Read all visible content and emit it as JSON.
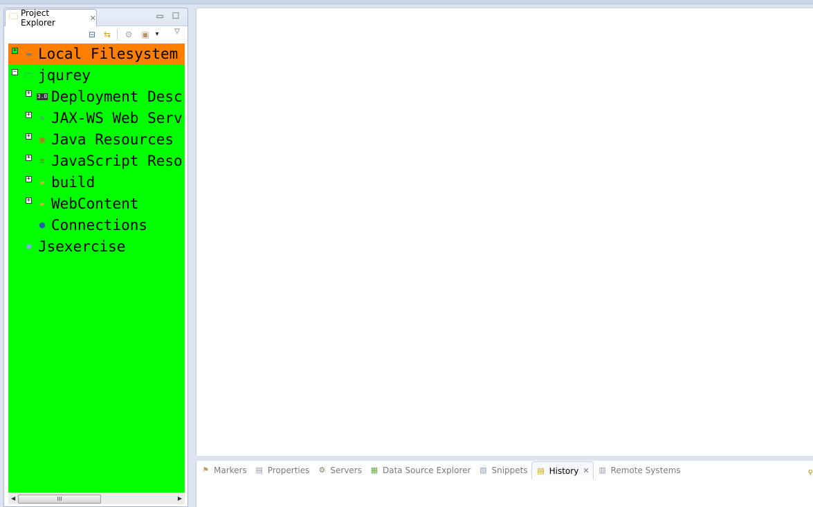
{
  "project_explorer": {
    "tab_label": "Project Explorer",
    "close_glyph": "✕",
    "minimize_glyph": "▭",
    "maximize_glyph": "☐",
    "toolbar": [
      {
        "name": "collapse-all-icon",
        "glyph": "⊟"
      },
      {
        "name": "link-with-editor-icon",
        "glyph": "⇆"
      },
      {
        "name": "filter-icon",
        "glyph": "⚙"
      },
      {
        "name": "package-icon",
        "glyph": "▣"
      },
      {
        "name": "dropdown-arrow-icon",
        "glyph": "▾"
      },
      {
        "name": "view-menu-icon",
        "glyph": "▽"
      }
    ],
    "tree": [
      {
        "label": "Local Filesystem",
        "icon": "drive-icon",
        "glyph": "▬",
        "level": 0,
        "expander": "+",
        "selected": true
      },
      {
        "label": "jqurey",
        "icon": "web-project-icon",
        "glyph": "🗁",
        "level": 0,
        "expander": "−",
        "selected": false
      },
      {
        "label": "Deployment Desc",
        "icon": "deployment-descriptor-icon",
        "glyph": "3.0",
        "level": 1,
        "expander": "+",
        "selected": false
      },
      {
        "label": "JAX-WS Web Serv",
        "icon": "web-services-icon",
        "glyph": "✎",
        "level": 1,
        "expander": "+",
        "selected": false
      },
      {
        "label": "Java Resources",
        "icon": "java-resources-icon",
        "glyph": "▦",
        "level": 1,
        "expander": "+",
        "selected": false
      },
      {
        "label": "JavaScript Reso",
        "icon": "javascript-resources-icon",
        "glyph": "≡",
        "level": 1,
        "expander": "+",
        "selected": false
      },
      {
        "label": "build",
        "icon": "folder-icon",
        "glyph": "▰",
        "level": 1,
        "expander": "+",
        "selected": false
      },
      {
        "label": "WebContent",
        "icon": "folder-icon",
        "glyph": "▰",
        "level": 1,
        "expander": "+",
        "selected": false
      },
      {
        "label": "Connections",
        "icon": "globe-icon",
        "glyph": "●",
        "level": 1,
        "expander": "",
        "selected": false
      },
      {
        "label": "Jsexercise",
        "icon": "closed-project-icon",
        "glyph": "■",
        "level": 0,
        "expander": "",
        "selected": false
      }
    ],
    "scrollbar": {
      "thumb_grip": "III",
      "left_arrow": "◀",
      "right_arrow": "▶"
    }
  },
  "bottom_panel": {
    "tabs": [
      {
        "label": "Markers",
        "icon": "markers-icon",
        "glyph": "⚑",
        "active": false
      },
      {
        "label": "Properties",
        "icon": "properties-icon",
        "glyph": "▤",
        "active": false
      },
      {
        "label": "Servers",
        "icon": "servers-icon",
        "glyph": "⚙",
        "active": false
      },
      {
        "label": "Data Source Explorer",
        "icon": "data-source-explorer-icon",
        "glyph": "▦",
        "active": false
      },
      {
        "label": "Snippets",
        "icon": "snippets-icon",
        "glyph": "▧",
        "active": false
      },
      {
        "label": "History",
        "icon": "history-icon",
        "glyph": "▤",
        "active": true
      },
      {
        "label": "Remote Systems",
        "icon": "remote-systems-icon",
        "glyph": "▥",
        "active": false
      }
    ],
    "close_glyph": "✕",
    "corner_glyph": "⚲"
  },
  "colors": {
    "tree_background": "#00ff00",
    "selection_background": "#ff7f00"
  }
}
